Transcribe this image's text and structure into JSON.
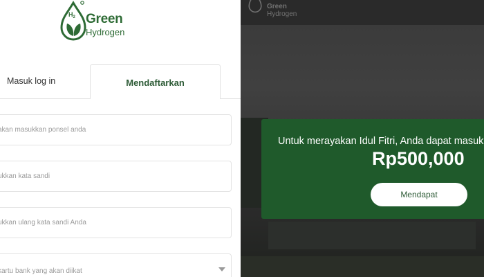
{
  "brand": {
    "logo_h2": "H2",
    "line1": "Green",
    "line2": "Hydrogen",
    "color": "#2e6b35"
  },
  "tabs": {
    "login_label": "Masuk log in",
    "register_label": "Mendaftarkan"
  },
  "form": {
    "phone_placeholder": "akan masukkan ponsel anda",
    "password_placeholder": "ukkan kata sandi",
    "confirm_placeholder": "ukkan ulang kata sandi Anda",
    "bank_placeholder": "kartu bank yang akan diikat"
  },
  "promo": {
    "message": "Untuk merayakan Idul Fitri, Anda dapat masuk",
    "amount": "Rp500,000",
    "button_label": "Mendapat",
    "bg_color": "#1f5a2b"
  },
  "background_logo": {
    "line1": "Green",
    "line2": "Hydrogen"
  }
}
